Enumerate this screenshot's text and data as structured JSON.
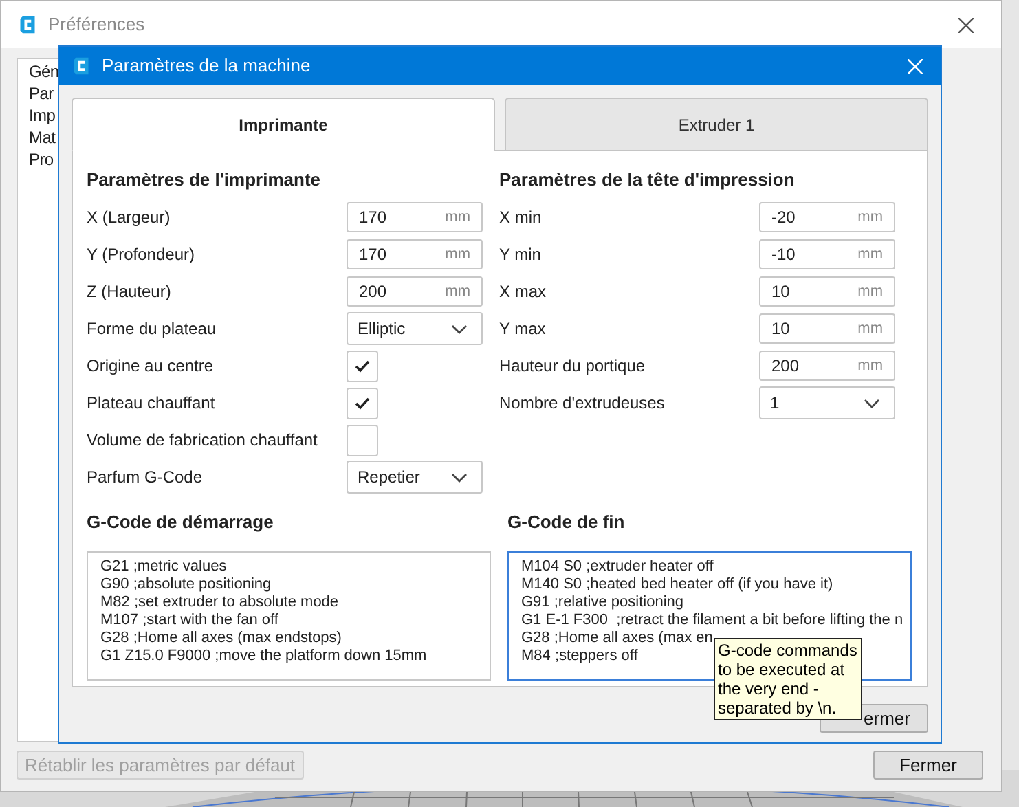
{
  "preferences_window": {
    "title": "Préférences",
    "sidebar_items": [
      {
        "label": "Gén",
        "selected": false
      },
      {
        "label": "Par",
        "selected": false
      },
      {
        "label": "Imp",
        "selected": false
      },
      {
        "label": "Mat",
        "selected": false
      },
      {
        "label": "Pro",
        "selected": false
      }
    ],
    "buttons": [
      {
        "label": "Rétablir les paramètres par défaut",
        "disabled": true
      },
      {
        "label": "Fermer",
        "disabled": false
      }
    ]
  },
  "dialog": {
    "title": "Paramètres de la machine",
    "tabs": [
      {
        "label": "Imprimante",
        "selected": true
      },
      {
        "label": "Extruder 1",
        "selected": false
      }
    ],
    "printer_settings": {
      "heading": "Paramètres de l'imprimante",
      "rows": [
        {
          "kind": "number",
          "label": "X (Largeur)",
          "value": "170",
          "unit": "mm"
        },
        {
          "kind": "number",
          "label": "Y (Profondeur)",
          "value": "170",
          "unit": "mm"
        },
        {
          "kind": "number",
          "label": "Z (Hauteur)",
          "value": "200",
          "unit": "mm"
        },
        {
          "kind": "dropdown",
          "label": "Forme du plateau",
          "value": "Elliptic"
        },
        {
          "kind": "checkbox",
          "label": "Origine au centre",
          "checked": true
        },
        {
          "kind": "checkbox",
          "label": "Plateau chauffant",
          "checked": true
        },
        {
          "kind": "checkbox",
          "label": "Volume de fabrication chauffant",
          "checked": false
        },
        {
          "kind": "dropdown",
          "label": "Parfum G-Code",
          "value": "Repetier"
        }
      ]
    },
    "printhead_settings": {
      "heading": "Paramètres de la tête d'impression",
      "rows": [
        {
          "kind": "number",
          "label": "X min",
          "value": "-20",
          "unit": "mm"
        },
        {
          "kind": "number",
          "label": "Y min",
          "value": "-10",
          "unit": "mm"
        },
        {
          "kind": "number",
          "label": "X max",
          "value": "10",
          "unit": "mm"
        },
        {
          "kind": "number",
          "label": "Y max",
          "value": "10",
          "unit": "mm"
        },
        {
          "kind": "number",
          "label": "Hauteur du portique",
          "value": "200",
          "unit": "mm"
        },
        {
          "kind": "dropdown",
          "label": "Nombre d'extrudeuses",
          "value": "1"
        }
      ]
    },
    "gcode_sections": [
      {
        "heading": "G-Code de démarrage",
        "focused": false,
        "lines": [
          "G21 ;metric values",
          "G90 ;absolute positioning",
          "M82 ;set extruder to absolute mode",
          "M107 ;start with the fan off",
          "G28 ;Home all axes (max endstops)",
          "G1 Z15.0 F9000 ;move the platform down 15mm"
        ]
      },
      {
        "heading": "G-Code de fin",
        "focused": true,
        "lines": [
          "M104 S0 ;extruder heater off",
          "M140 S0 ;heated bed heater off (if you have it)",
          "G91 ;relative positioning",
          "G1 E-1 F300  ;retract the filament a bit before lifting the n",
          "G28 ;Home all axes (max en",
          "M84 ;steppers off"
        ]
      }
    ],
    "close_button": "ermer",
    "tooltip": "G-code commands to be executed at the very end - separated by \\n."
  }
}
